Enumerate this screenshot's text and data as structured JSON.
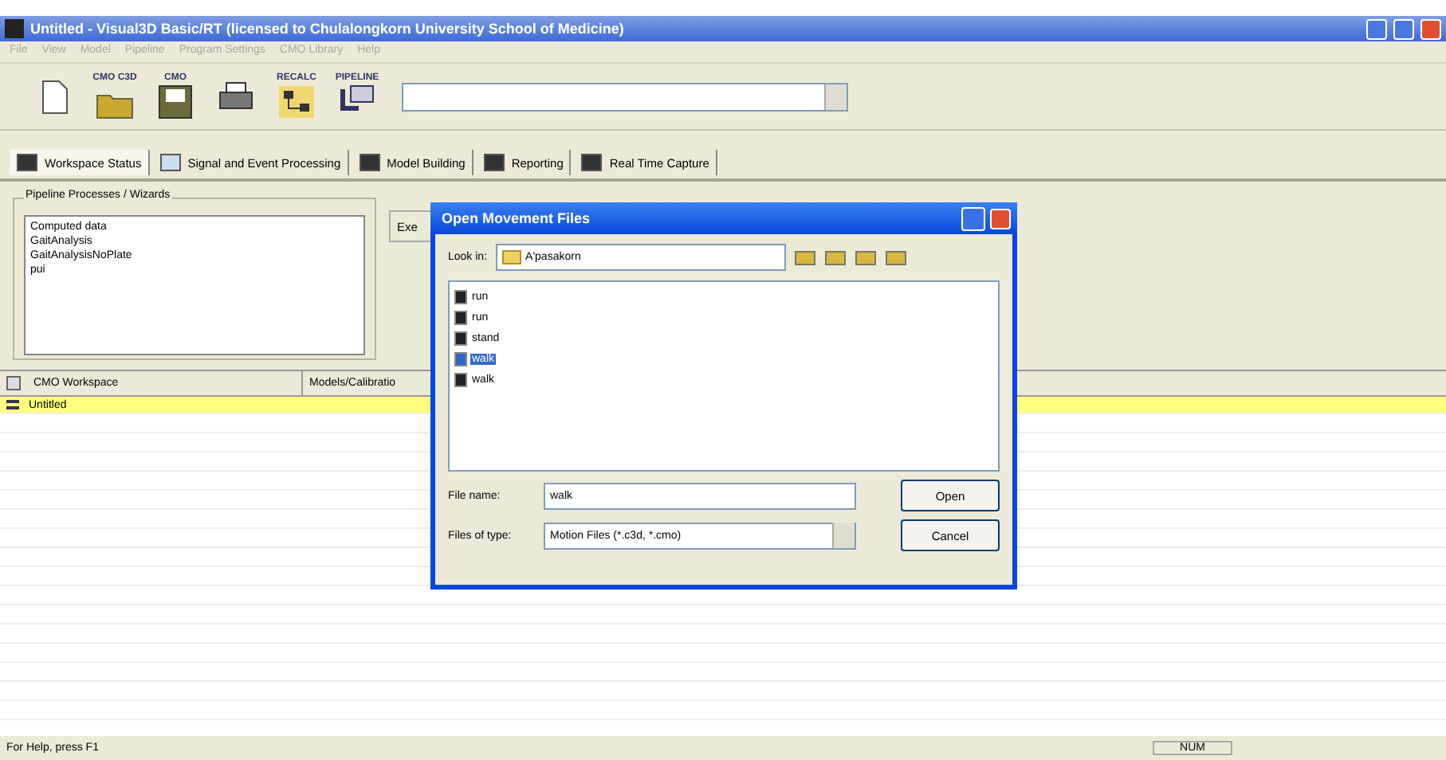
{
  "window": {
    "title": "Untitled - Visual3D Basic/RT (licensed to Chulalongkorn University School of Medicine)"
  },
  "menu": [
    {
      "label": "File",
      "disabled": true
    },
    {
      "label": "View",
      "disabled": true
    },
    {
      "label": "Model",
      "disabled": true
    },
    {
      "label": "Pipeline",
      "disabled": true
    },
    {
      "label": "Program Settings",
      "disabled": true
    },
    {
      "label": "CMO Library",
      "disabled": true
    },
    {
      "label": "Help",
      "disabled": true
    }
  ],
  "toolbar": {
    "buttons": [
      {
        "kind": "new"
      },
      {
        "kind": "open",
        "caption": "CMO C3D"
      },
      {
        "kind": "save",
        "caption": "CMO"
      },
      {
        "kind": "print"
      },
      {
        "kind": "recalc",
        "caption": "RECALC"
      },
      {
        "kind": "pipeline",
        "caption": "PIPELINE"
      }
    ]
  },
  "tabs": [
    {
      "label": "Workspace Status",
      "kind": "status",
      "selected": true
    },
    {
      "label": "Signal and Event Processing",
      "kind": "signal",
      "selected": false
    },
    {
      "label": "Model Building",
      "kind": "model",
      "selected": false
    },
    {
      "label": "Reporting",
      "kind": "report",
      "selected": false
    },
    {
      "label": "Real Time Capture",
      "kind": "capture",
      "selected": false
    }
  ],
  "pipeline": {
    "title": "Pipeline Processes / Wizards",
    "items": [
      "Computed data",
      "GaitAnalysis",
      "GaitAnalysisNoPlate",
      "pui"
    ],
    "button": "Exe"
  },
  "table": {
    "columns": [
      "CMO Workspace",
      "Models/Calibratio"
    ],
    "rows": [
      {
        "cells": [
          "Untitled"
        ],
        "selected": true
      }
    ]
  },
  "dialog": {
    "title": "Open Movement Files",
    "look_in_label": "Look in:",
    "look_in": "A'pasakorn",
    "files": [
      {
        "name": "run",
        "selected": false
      },
      {
        "name": "run",
        "selected": false
      },
      {
        "name": "stand",
        "selected": false
      },
      {
        "name": "walk",
        "selected": true
      },
      {
        "name": "walk",
        "selected": false
      }
    ],
    "file_name_label": "File name:",
    "file_name": "walk",
    "type_label": "Files of type:",
    "type": "Motion Files (*.c3d, *.cmo)",
    "buttons": [
      "Open",
      "Cancel"
    ]
  },
  "status_bar": {
    "text": "For Help, press F1",
    "indicator": "NUM"
  }
}
